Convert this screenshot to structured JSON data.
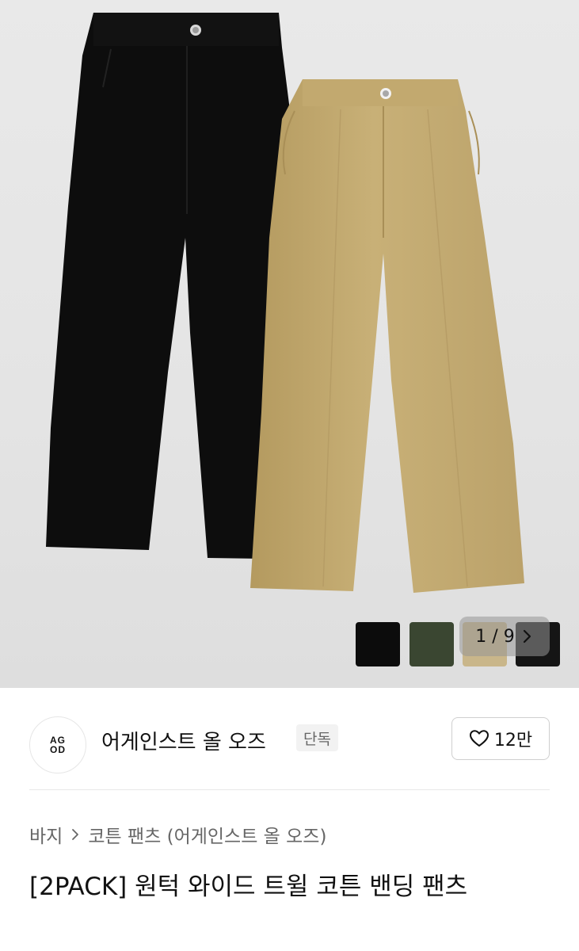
{
  "gallery": {
    "counter_text": "1 / 9",
    "swatch_colors": [
      "#0c0c0c",
      "#3a4631",
      "#c9b68a",
      "#151515"
    ],
    "next_icon": "chevron-right-icon"
  },
  "brand": {
    "logo_top": "AG",
    "logo_bottom": "OD",
    "name": "어게인스트 올 오즈",
    "badge": "단독",
    "like_count": "12만",
    "like_icon": "heart-outline-icon"
  },
  "breadcrumb": {
    "items": [
      "바지",
      "코튼 팬츠 (어게인스트 올 오즈)"
    ],
    "separator_icon": "chevron-right-icon"
  },
  "product": {
    "title": "[2PACK] 원턱 와이드 트윌 코튼 밴딩 팬츠"
  }
}
